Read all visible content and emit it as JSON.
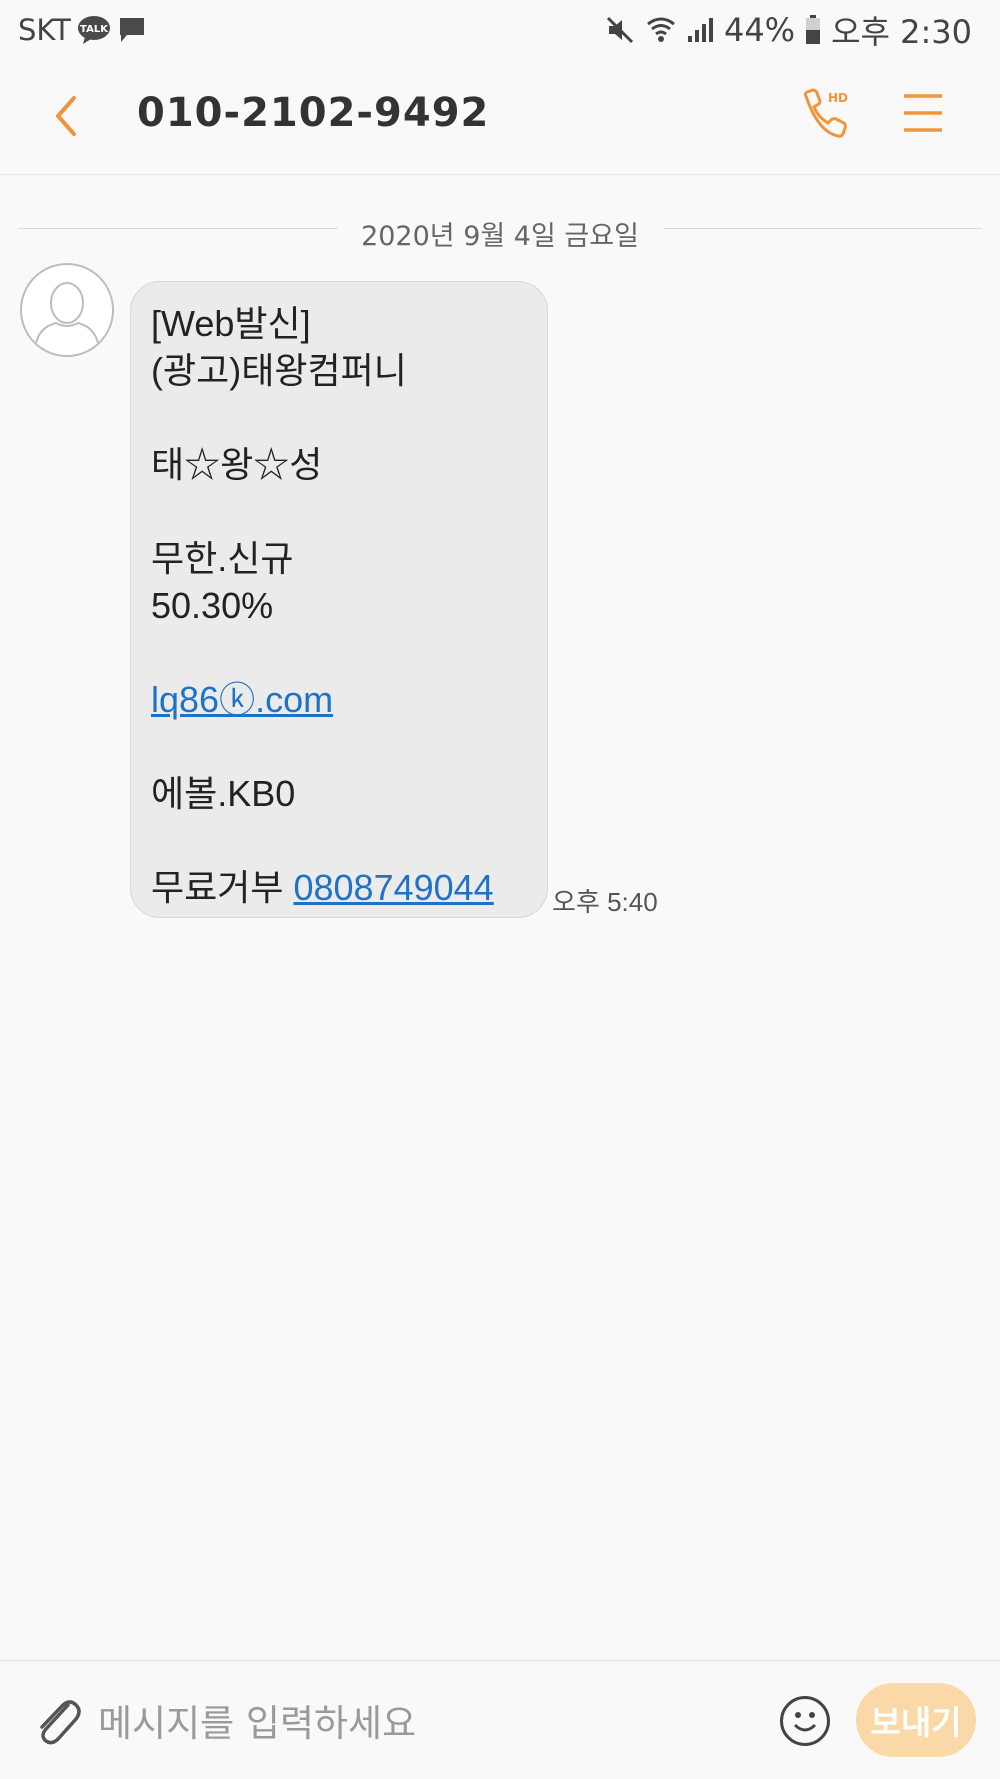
{
  "status_bar": {
    "carrier": "SKT",
    "talk_badge": "TALK",
    "battery": "44%",
    "time": "오후 2:30"
  },
  "app_bar": {
    "title": "010-2102-9492",
    "call_badge": "HD"
  },
  "conversation": {
    "date_separator": "2020년 9월 4일 금요일",
    "message": {
      "lines": [
        "[Web발신]",
        "(광고)태왕컴퍼니",
        "",
        "태☆왕☆성",
        "",
        "무한.신규",
        "50.30%",
        "",
        "lq86ⓚ.com",
        "",
        "에볼.KB0",
        "",
        "무료거부 ",
        "0808749044"
      ],
      "time": "오후 5:40"
    }
  },
  "composer": {
    "placeholder": "메시지를 입력하세요",
    "send_label": "보내기"
  },
  "colors": {
    "accent": "#f0953b",
    "link": "#1e73c8",
    "bubble": "#ebebeb",
    "send_button": "#fbd8a7"
  }
}
